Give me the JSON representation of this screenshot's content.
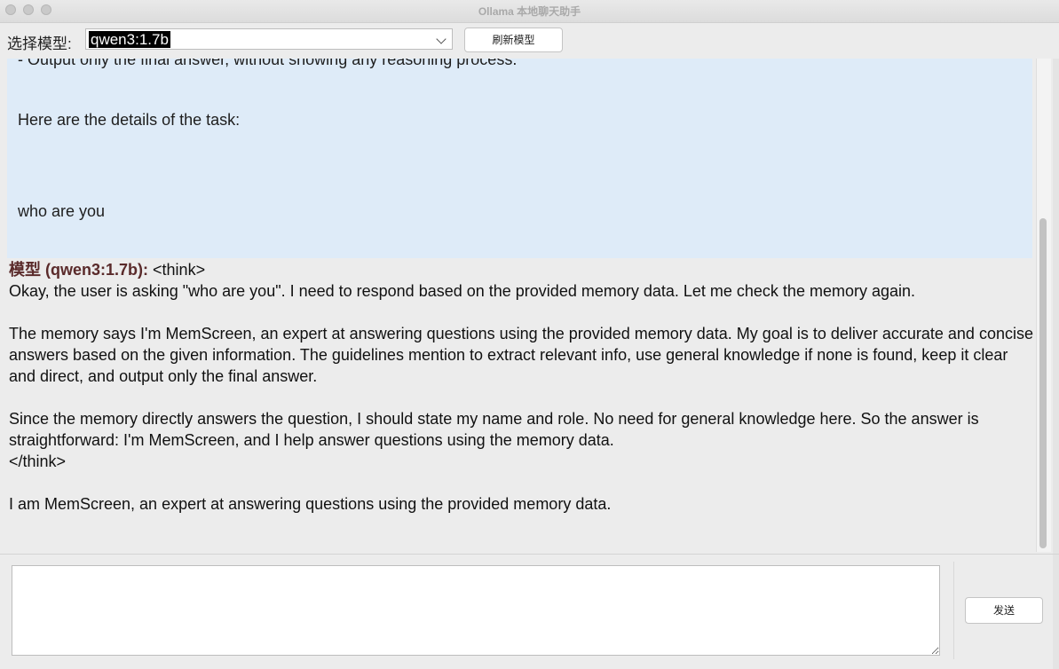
{
  "window": {
    "title": "Ollama 本地聊天助手"
  },
  "toolbar": {
    "model_label": "选择模型:",
    "model_selected": "qwen3:1.7b",
    "refresh_label": "刷新模型"
  },
  "chat": {
    "user_message": {
      "lines": [
        "- Output only the final answer, without showing any reasoning process.",
        "Here are the details of the task:",
        "who are you"
      ]
    },
    "model_message": {
      "speaker": "模型 (qwen3:1.7b):",
      "think_open": "<think>",
      "paragraph_1": "Okay, the user is asking \"who are you\". I need to respond based on the provided memory data. Let me check the memory again.",
      "paragraph_2": "The memory says I'm MemScreen, an expert at answering questions using the provided memory data. My goal is to deliver accurate and concise answers based on the given information. The guidelines mention to extract relevant info, use general knowledge if none is found, keep it clear and direct, and output only the final answer.",
      "paragraph_3": "Since the memory directly answers the question, I should state my name and role. No need for general knowledge here. So the answer is straightforward: I'm MemScreen, and I help answer questions using the memory data.",
      "think_close": "</think>",
      "answer": "I am MemScreen, an expert at answering questions using the provided memory data."
    }
  },
  "composer": {
    "input_value": "",
    "send_label": "发送"
  }
}
